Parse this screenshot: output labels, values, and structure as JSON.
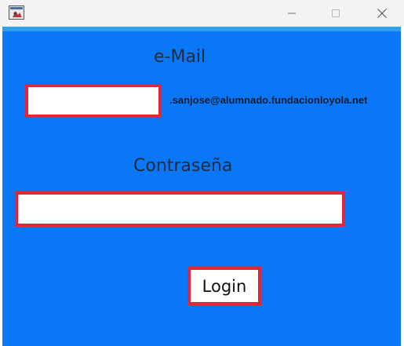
{
  "window": {
    "controls": {
      "minimize_icon": "minimize-icon",
      "maximize_icon": "maximize-icon",
      "close_icon": "close-icon"
    }
  },
  "form": {
    "email_label": "e-Mail",
    "email_value": "",
    "email_domain": ".sanjose@alumnado.fundacionloyola.net",
    "password_label": "Contraseña",
    "password_value": "",
    "login_label": "Login"
  },
  "colors": {
    "background": "#0a78f6",
    "field_border": "#e1253a",
    "label_text": "#1f2a3a"
  }
}
